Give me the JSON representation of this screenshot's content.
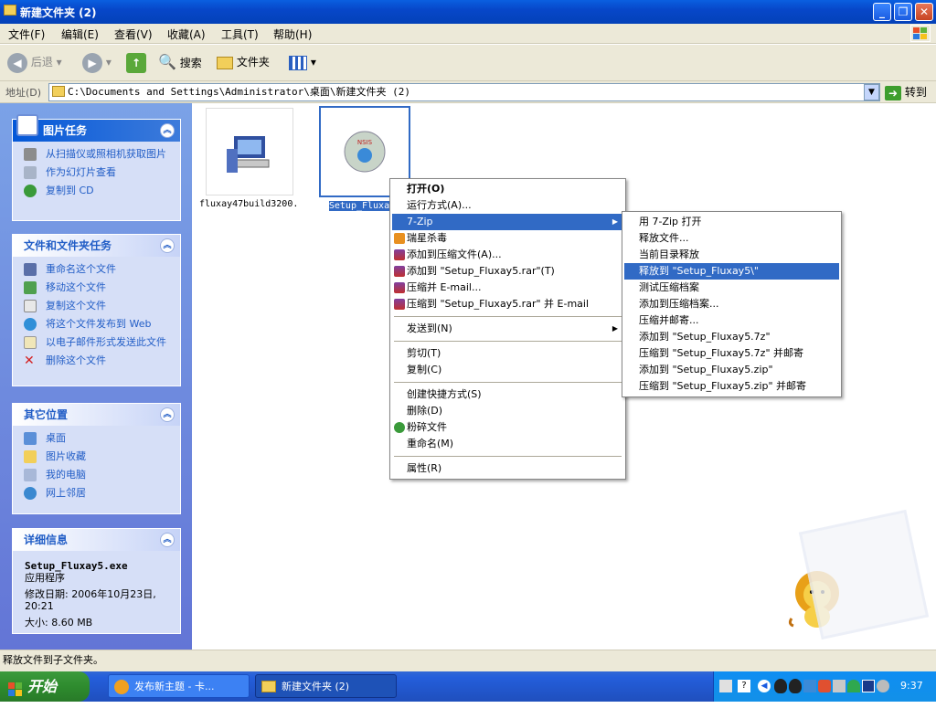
{
  "window": {
    "title": "新建文件夹 (2)"
  },
  "menubar": [
    {
      "label": "文件(F)"
    },
    {
      "label": "编辑(E)"
    },
    {
      "label": "查看(V)"
    },
    {
      "label": "收藏(A)"
    },
    {
      "label": "工具(T)"
    },
    {
      "label": "帮助(H)"
    }
  ],
  "toolbar": {
    "back": "后退",
    "search": "搜索",
    "folders": "文件夹"
  },
  "address": {
    "label": "地址(D)",
    "value": "C:\\Documents and Settings\\Administrator\\桌面\\新建文件夹 (2)",
    "go": "转到"
  },
  "sidebar": {
    "picture_tasks": {
      "title": "图片任务",
      "items": [
        "从扫描仪或照相机获取图片",
        "作为幻灯片查看",
        "复制到 CD"
      ]
    },
    "file_tasks": {
      "title": "文件和文件夹任务",
      "items": [
        "重命名这个文件",
        "移动这个文件",
        "复制这个文件",
        "将这个文件发布到 Web",
        "以电子邮件形式发送此文件",
        "删除这个文件"
      ]
    },
    "other_places": {
      "title": "其它位置",
      "items": [
        "桌面",
        "图片收藏",
        "我的电脑",
        "网上邻居"
      ]
    },
    "details": {
      "title": "详细信息",
      "filename": "Setup_Fluxay5.exe",
      "type": "应用程序",
      "modified": "修改日期: 2006年10月23日, 20:21",
      "size": "大小: 8.60 MB"
    }
  },
  "files": [
    {
      "label": "fluxay47build3200..."
    },
    {
      "label": "Setup_Fluxay5"
    }
  ],
  "context_menu": [
    {
      "label": "打开(O)"
    },
    {
      "label": "运行方式(A)..."
    },
    {
      "label": "7-Zip"
    },
    {
      "label": "瑞星杀毒"
    },
    {
      "label": "添加到压缩文件(A)..."
    },
    {
      "label": "添加到 \"Setup_Fluxay5.rar\"(T)"
    },
    {
      "label": "压缩并 E-mail..."
    },
    {
      "label": "压缩到 \"Setup_Fluxay5.rar\" 并 E-mail"
    },
    {
      "label": "发送到(N)"
    },
    {
      "label": "剪切(T)"
    },
    {
      "label": "复制(C)"
    },
    {
      "label": "创建快捷方式(S)"
    },
    {
      "label": "删除(D)"
    },
    {
      "label": "粉碎文件"
    },
    {
      "label": "重命名(M)"
    },
    {
      "label": "属性(R)"
    }
  ],
  "submenu": [
    {
      "label": "用 7-Zip 打开"
    },
    {
      "label": "释放文件..."
    },
    {
      "label": "当前目录释放"
    },
    {
      "label": "释放到 \"Setup_Fluxay5\\\""
    },
    {
      "label": "测试压缩档案"
    },
    {
      "label": "添加到压缩档案..."
    },
    {
      "label": "压缩并邮寄..."
    },
    {
      "label": "添加到 \"Setup_Fluxay5.7z\""
    },
    {
      "label": "压缩到 \"Setup_Fluxay5.7z\" 并邮寄"
    },
    {
      "label": "添加到 \"Setup_Fluxay5.zip\""
    },
    {
      "label": "压缩到 \"Setup_Fluxay5.zip\" 并邮寄"
    }
  ],
  "status": "释放文件到子文件夹。",
  "taskbar": {
    "start": "开始",
    "tasks": [
      {
        "label": "发布新主题 - 卡..."
      },
      {
        "label": "新建文件夹 (2)"
      }
    ],
    "clock": "9:37"
  }
}
